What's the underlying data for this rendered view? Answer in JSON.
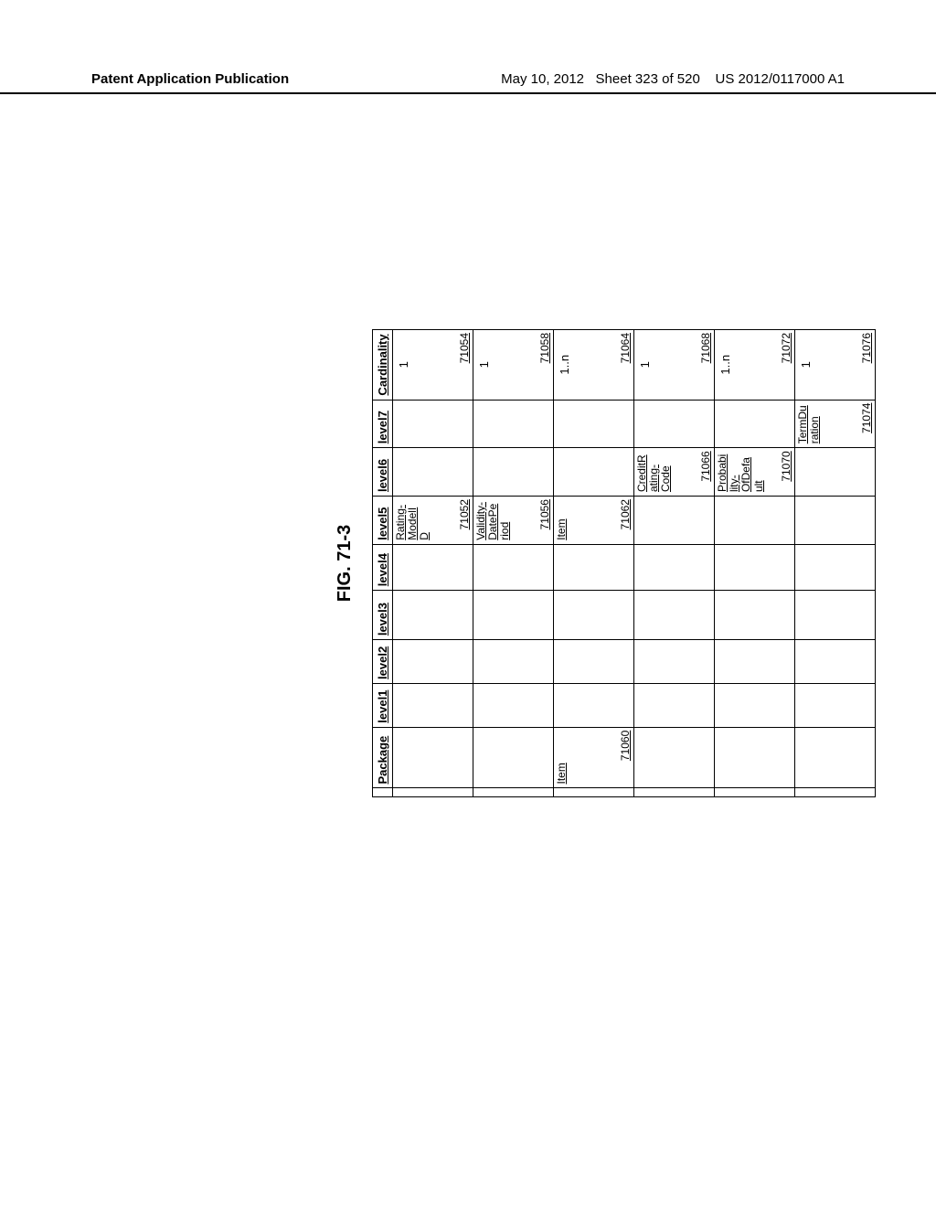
{
  "header": {
    "left": "Patent Application Publication",
    "date": "May 10, 2012",
    "sheet": "Sheet 323 of 520",
    "pubno": "US 2012/0117000 A1"
  },
  "figure": {
    "title": "FIG. 71-3"
  },
  "columns": {
    "stub": "",
    "package": "Package",
    "level1": "level1",
    "level2": "level2",
    "level3": "level3",
    "level4": "level4",
    "level5": "level5",
    "level6": "level6",
    "level7": "level7",
    "cardinality": "Cardinality"
  },
  "rows": [
    {
      "package_text": "",
      "package_ref": "",
      "level5_text": "Rating-ModelID",
      "level5_ref": "71052",
      "level6_text": "",
      "level6_ref": "",
      "level7_text": "",
      "level7_ref": "",
      "card_val": "1",
      "card_ref": "71054"
    },
    {
      "package_text": "",
      "package_ref": "",
      "level5_text": "Validity-DatePeriod",
      "level5_ref": "71056",
      "level6_text": "",
      "level6_ref": "",
      "level7_text": "",
      "level7_ref": "",
      "card_val": "1",
      "card_ref": "71058"
    },
    {
      "package_text": "Item",
      "package_ref": "71060",
      "level5_text": "Item",
      "level5_ref": "71062",
      "level6_text": "",
      "level6_ref": "",
      "level7_text": "",
      "level7_ref": "",
      "card_val": "1..n",
      "card_ref": "71064"
    },
    {
      "package_text": "",
      "package_ref": "",
      "level5_text": "",
      "level5_ref": "",
      "level6_text": "CreditRating-Code",
      "level6_ref": "71066",
      "level7_text": "",
      "level7_ref": "",
      "card_val": "1",
      "card_ref": "71068"
    },
    {
      "package_text": "",
      "package_ref": "",
      "level5_text": "",
      "level5_ref": "",
      "level6_text": "Probability-OfDefault",
      "level6_ref": "71070",
      "level7_text": "",
      "level7_ref": "",
      "card_val": "1..n",
      "card_ref": "71072"
    },
    {
      "package_text": "",
      "package_ref": "",
      "level5_text": "",
      "level5_ref": "",
      "level6_text": "",
      "level6_ref": "",
      "level7_text": "TermDuration",
      "level7_ref": "71074",
      "card_val": "1",
      "card_ref": "71076"
    }
  ]
}
